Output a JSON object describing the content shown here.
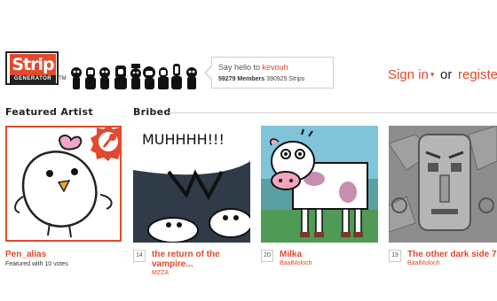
{
  "header": {
    "logo": {
      "top": "Strip",
      "bottom": "GENERATOR",
      "tm": "TM"
    },
    "greeting": {
      "prefix": "Say hello to",
      "user": "kevouh"
    },
    "stats": {
      "members_count": "59279",
      "members_label": "Members",
      "strips": "390925 Strips"
    },
    "signin": {
      "label": "Sign in",
      "caret": "▾",
      "or": "or",
      "register": "registe"
    }
  },
  "featured": {
    "title": "Featured Artist",
    "artist_name": "Pen_alias",
    "subtitle": "Featured with 10 votes"
  },
  "bribed": {
    "title": "Bribed",
    "items": [
      {
        "number": "14",
        "title_line1": "the return of the",
        "title_line2": "vampire...",
        "author": "MZZA",
        "panel_text": "MUHHHH!!!"
      },
      {
        "number": "20",
        "title_line1": "Milka",
        "title_line2": "",
        "author": "BaalMoloch",
        "panel_text": ""
      },
      {
        "number": "19",
        "title_line1": "The other dark side 7",
        "title_line2": "",
        "author": "BaalMoloch",
        "panel_text": ""
      }
    ]
  },
  "colors": {
    "accent": "#e2492d",
    "text": "#222222",
    "rule": "#cfcfcf"
  }
}
